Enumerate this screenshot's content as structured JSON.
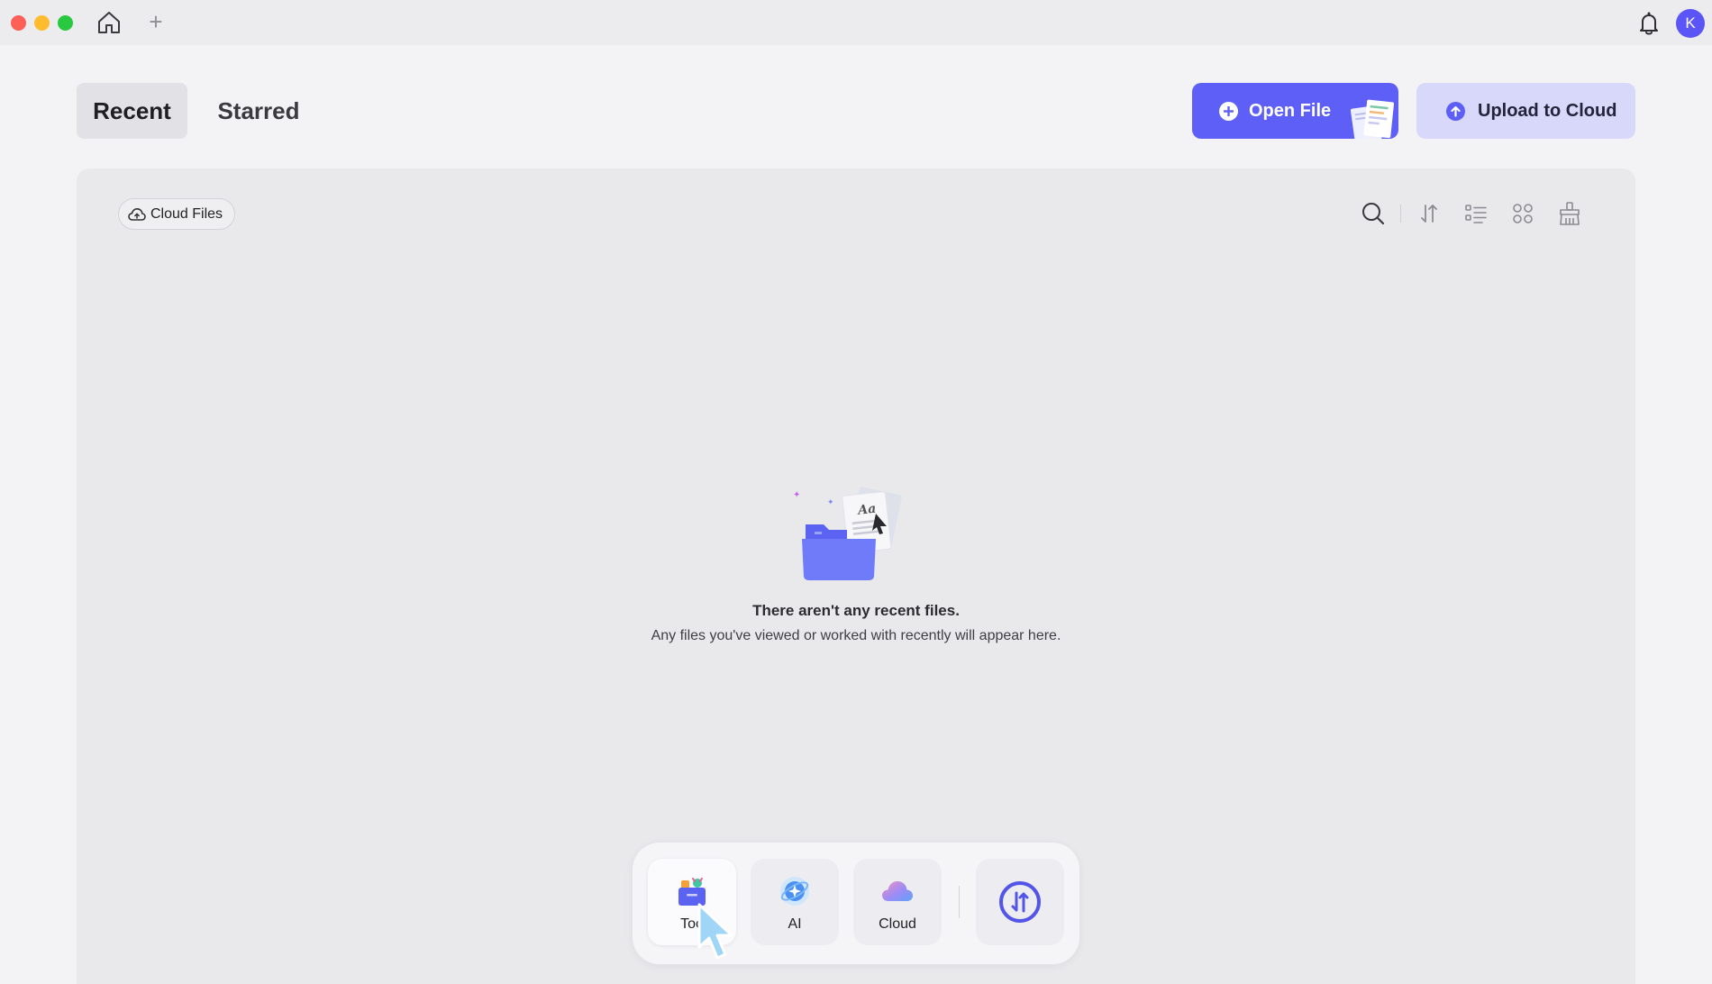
{
  "titlebar": {
    "avatar_initial": "K",
    "new_tab_symbol": "+"
  },
  "tabs": [
    {
      "label": "Recent",
      "selected": true
    },
    {
      "label": "Starred",
      "selected": false
    }
  ],
  "actions": {
    "open_file": "Open File",
    "upload_to_cloud": "Upload to Cloud"
  },
  "panel": {
    "cloud_files_label": "Cloud Files",
    "toolbar_icons": [
      "search-icon",
      "sort-icon",
      "list-view-icon",
      "grid-view-icon",
      "clear-icon"
    ]
  },
  "empty_state": {
    "title": "There aren't any recent files.",
    "subtitle": "Any files you've viewed or worked with recently will appear here."
  },
  "dock": {
    "items": [
      {
        "label": "Too",
        "icon": "tools-icon",
        "active": true
      },
      {
        "label": "AI",
        "icon": "ai-icon",
        "active": false
      },
      {
        "label": "Cloud",
        "icon": "cloud-icon",
        "active": false
      }
    ],
    "convert_icon": "convert-icon"
  },
  "colors": {
    "accent": "#5e5ff6",
    "accent_light": "#d8d8fb",
    "avatar": "#5b55f7"
  }
}
